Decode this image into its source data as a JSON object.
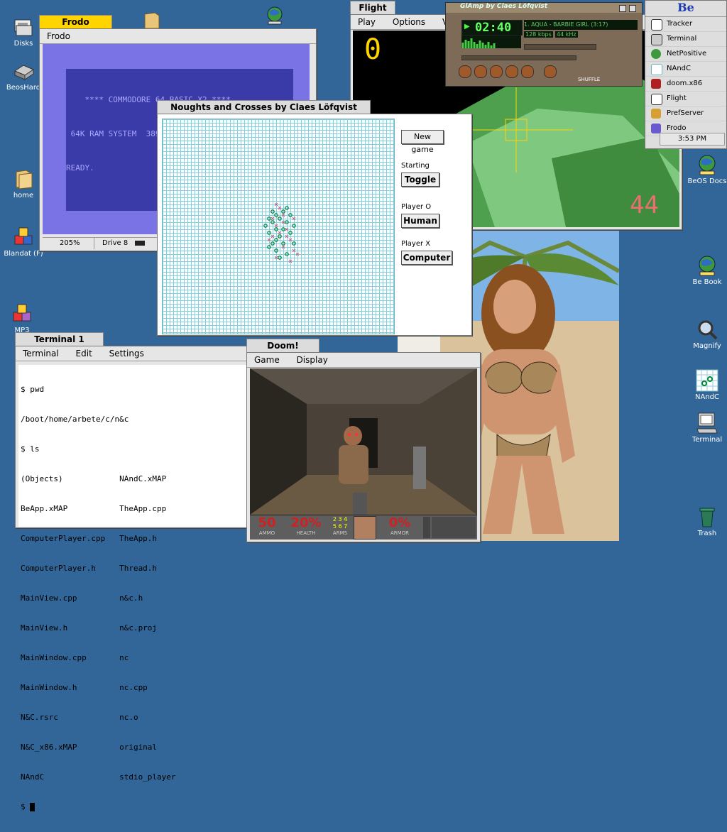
{
  "desktop": {
    "left_icons": [
      {
        "label": "Disks"
      },
      {
        "label": "BeosHard"
      },
      {
        "label": "home"
      },
      {
        "label": "Blandat (F)"
      },
      {
        "label": "MP3"
      }
    ],
    "right_icons": [
      {
        "label": "BeOS Docs"
      },
      {
        "label": "Be Book"
      },
      {
        "label": "Magnify"
      },
      {
        "label": "NAndC"
      },
      {
        "label": "Terminal"
      },
      {
        "label": "Trash"
      }
    ]
  },
  "deskbar": {
    "logo": "Be",
    "items": [
      {
        "label": "Tracker"
      },
      {
        "label": "Terminal"
      },
      {
        "label": "NetPositive"
      },
      {
        "label": "NAndC"
      },
      {
        "label": "doom.x86"
      },
      {
        "label": "Flight"
      },
      {
        "label": "PrefServer"
      },
      {
        "label": "Frodo"
      }
    ],
    "clock": "3:53 PM"
  },
  "frodo": {
    "tab": "Frodo",
    "title": "Frodo",
    "screen_lines": [
      "    **** COMMODORE 64 BASIC X2 ****",
      " 64K RAM SYSTEM  38911 BASIC BYTES FREE",
      "READY."
    ],
    "status_speed": "205%",
    "status_drive": "Drive 8"
  },
  "flight": {
    "tab": "Flight",
    "menu": [
      "Play",
      "Options",
      "Vie"
    ],
    "score": "0",
    "counter": "44"
  },
  "glamp": {
    "title": "GlAmp  by Claes Löfqvist",
    "time": "02:40",
    "track": "1. AQUA - BARBIE GIRL (3:17)",
    "bitrate": "128 kbps",
    "freq": "44 kHz",
    "shuffle": "SHUFFLE"
  },
  "nandc": {
    "tab": "Noughts and Crosses  by Claes Löfqvist",
    "new_game": "New game",
    "starting_label": "Starting",
    "toggle": "Toggle",
    "player_o_label": "Player O",
    "player_o_value": "Human",
    "player_x_label": "Player X",
    "player_x_value": "Computer"
  },
  "terminal": {
    "tab": "Terminal 1",
    "menu": [
      "Terminal",
      "Edit",
      "Settings"
    ],
    "lines": [
      "$ pwd",
      "/boot/home/arbete/c/n&c",
      "$ ls",
      "(Objects)            NAndC.xMAP",
      "BeApp.xMAP           TheApp.cpp",
      "ComputerPlayer.cpp   TheApp.h",
      "ComputerPlayer.h     Thread.h",
      "MainView.cpp         n&c.h",
      "MainView.h           n&c.proj",
      "MainWindow.cpp       nc",
      "MainWindow.h         nc.cpp",
      "N&C.rsrc             nc.o",
      "N&C_x86.xMAP         original",
      "NAndC                stdio_player",
      "$ "
    ]
  },
  "doom": {
    "tab": "Doom!",
    "menu": [
      "Game",
      "Display"
    ],
    "ammo": "50",
    "ammo_label": "AMMO",
    "health": "20%",
    "health_label": "HEALTH",
    "arms_label": "ARMS",
    "armor": "0%",
    "armor_label": "ARMOR"
  }
}
